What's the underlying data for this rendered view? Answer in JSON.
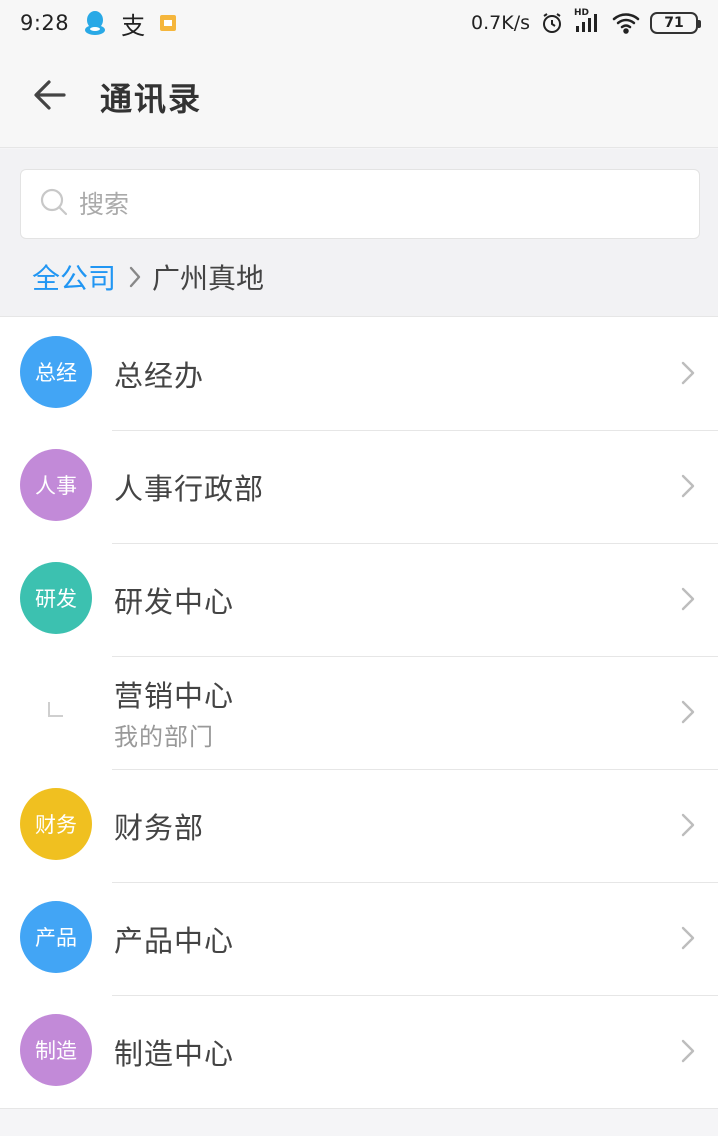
{
  "status_bar": {
    "time": "9:28",
    "net_speed": "0.7K/s",
    "hd_label": "HD",
    "battery": "71",
    "pay_glyph": "支",
    "icons": [
      "qq-icon",
      "alipay-icon",
      "notification-icon",
      "alarm-icon",
      "signal-icon",
      "wifi-icon",
      "battery-icon"
    ]
  },
  "header": {
    "title": "通讯录"
  },
  "search": {
    "placeholder": "搜索"
  },
  "breadcrumb": {
    "root": "全公司",
    "current": "广州真地"
  },
  "departments": [
    {
      "name": "总经办",
      "avatar_text": "总经",
      "color": "#42a5f5"
    },
    {
      "name": "人事行政部",
      "avatar_text": "人事",
      "color": "#c28ad8"
    },
    {
      "name": "研发中心",
      "avatar_text": "研发",
      "color": "#3cc1b0"
    },
    {
      "name": "营销中心",
      "avatar_text": "",
      "subtitle": "我的部门",
      "color": ""
    },
    {
      "name": "财务部",
      "avatar_text": "财务",
      "color": "#f0c020"
    },
    {
      "name": "产品中心",
      "avatar_text": "产品",
      "color": "#42a5f5"
    },
    {
      "name": "制造中心",
      "avatar_text": "制造",
      "color": "#c28ad8"
    }
  ],
  "colors": {
    "accent": "#2196f3",
    "divider": "#e6e6e6"
  }
}
